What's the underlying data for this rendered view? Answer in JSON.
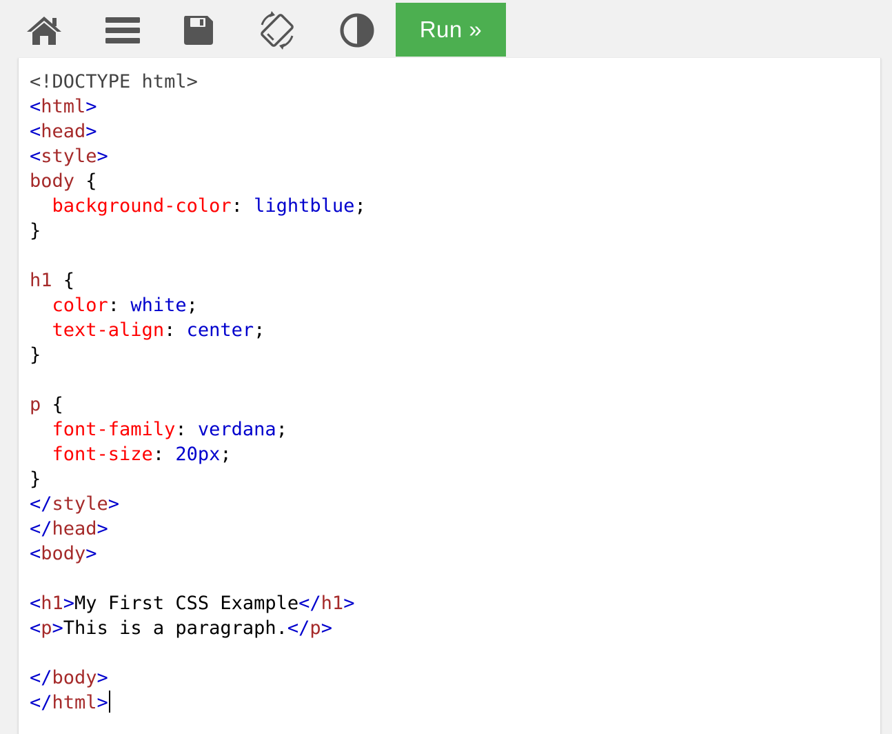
{
  "toolbar": {
    "icons": [
      "home-icon",
      "menu-icon",
      "save-icon",
      "rotate-icon",
      "contrast-icon"
    ],
    "run_label": "Run »",
    "icon_color": "#555555",
    "run_color": "#4caf50"
  },
  "editor": {
    "lines": [
      [
        {
          "t": "<!DOCTYPE html>",
          "c": "doctype"
        }
      ],
      [
        {
          "t": "<",
          "c": "tag"
        },
        {
          "t": "html",
          "c": "tagname"
        },
        {
          "t": ">",
          "c": "tag"
        }
      ],
      [
        {
          "t": "<",
          "c": "tag"
        },
        {
          "t": "head",
          "c": "tagname"
        },
        {
          "t": ">",
          "c": "tag"
        }
      ],
      [
        {
          "t": "<",
          "c": "tag"
        },
        {
          "t": "style",
          "c": "tagname"
        },
        {
          "t": ">",
          "c": "tag"
        }
      ],
      [
        {
          "t": "body",
          "c": "selector"
        },
        {
          "t": " {",
          "c": "plain"
        }
      ],
      [
        {
          "t": "  ",
          "c": "plain"
        },
        {
          "t": "background-color",
          "c": "prop"
        },
        {
          "t": ": ",
          "c": "plain"
        },
        {
          "t": "lightblue",
          "c": "value"
        },
        {
          "t": ";",
          "c": "plain"
        }
      ],
      [
        {
          "t": "}",
          "c": "plain"
        }
      ],
      [],
      [
        {
          "t": "h1",
          "c": "selector"
        },
        {
          "t": " {",
          "c": "plain"
        }
      ],
      [
        {
          "t": "  ",
          "c": "plain"
        },
        {
          "t": "color",
          "c": "prop"
        },
        {
          "t": ": ",
          "c": "plain"
        },
        {
          "t": "white",
          "c": "value"
        },
        {
          "t": ";",
          "c": "plain"
        }
      ],
      [
        {
          "t": "  ",
          "c": "plain"
        },
        {
          "t": "text-align",
          "c": "prop"
        },
        {
          "t": ": ",
          "c": "plain"
        },
        {
          "t": "center",
          "c": "value"
        },
        {
          "t": ";",
          "c": "plain"
        }
      ],
      [
        {
          "t": "}",
          "c": "plain"
        }
      ],
      [],
      [
        {
          "t": "p",
          "c": "selector"
        },
        {
          "t": " {",
          "c": "plain"
        }
      ],
      [
        {
          "t": "  ",
          "c": "plain"
        },
        {
          "t": "font-family",
          "c": "prop"
        },
        {
          "t": ": ",
          "c": "plain"
        },
        {
          "t": "verdana",
          "c": "value"
        },
        {
          "t": ";",
          "c": "plain"
        }
      ],
      [
        {
          "t": "  ",
          "c": "plain"
        },
        {
          "t": "font-size",
          "c": "prop"
        },
        {
          "t": ": ",
          "c": "plain"
        },
        {
          "t": "20px",
          "c": "value"
        },
        {
          "t": ";",
          "c": "plain"
        }
      ],
      [
        {
          "t": "}",
          "c": "plain"
        }
      ],
      [
        {
          "t": "</",
          "c": "tag"
        },
        {
          "t": "style",
          "c": "tagname"
        },
        {
          "t": ">",
          "c": "tag"
        }
      ],
      [
        {
          "t": "</",
          "c": "tag"
        },
        {
          "t": "head",
          "c": "tagname"
        },
        {
          "t": ">",
          "c": "tag"
        }
      ],
      [
        {
          "t": "<",
          "c": "tag"
        },
        {
          "t": "body",
          "c": "tagname"
        },
        {
          "t": ">",
          "c": "tag"
        }
      ],
      [],
      [
        {
          "t": "<",
          "c": "tag"
        },
        {
          "t": "h1",
          "c": "tagname"
        },
        {
          "t": ">",
          "c": "tag"
        },
        {
          "t": "My First CSS Example",
          "c": "plain"
        },
        {
          "t": "</",
          "c": "tag"
        },
        {
          "t": "h1",
          "c": "tagname"
        },
        {
          "t": ">",
          "c": "tag"
        }
      ],
      [
        {
          "t": "<",
          "c": "tag"
        },
        {
          "t": "p",
          "c": "tagname"
        },
        {
          "t": ">",
          "c": "tag"
        },
        {
          "t": "This is a paragraph.",
          "c": "plain"
        },
        {
          "t": "</",
          "c": "tag"
        },
        {
          "t": "p",
          "c": "tagname"
        },
        {
          "t": ">",
          "c": "tag"
        }
      ],
      [],
      [
        {
          "t": "</",
          "c": "tag"
        },
        {
          "t": "body",
          "c": "tagname"
        },
        {
          "t": ">",
          "c": "tag"
        }
      ],
      [
        {
          "t": "</",
          "c": "tag"
        },
        {
          "t": "html",
          "c": "tagname"
        },
        {
          "t": ">",
          "c": "tag"
        }
      ]
    ],
    "caret_line": 25
  }
}
